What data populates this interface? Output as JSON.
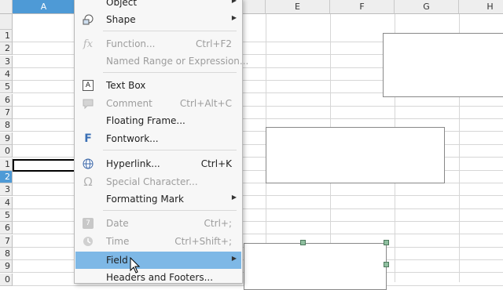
{
  "spreadsheet": {
    "columns": [
      {
        "label": "A",
        "selected": true
      },
      {
        "label": "",
        "selected": false
      },
      {
        "label": "",
        "selected": false
      },
      {
        "label": "",
        "selected": false
      },
      {
        "label": "E",
        "selected": false
      },
      {
        "label": "F",
        "selected": false
      },
      {
        "label": "G",
        "selected": false
      },
      {
        "label": "H",
        "selected": false
      }
    ],
    "rows": [
      "1",
      "2",
      "3",
      "4",
      "5",
      "6",
      "7",
      "8",
      "9",
      "0",
      "1",
      "2",
      "3",
      "4",
      "5",
      "6",
      "7",
      "8",
      "9",
      "0"
    ],
    "selected_row_index": 11,
    "selection_color": "#4e9ad6"
  },
  "context_menu": {
    "items": {
      "object": {
        "label": "Object",
        "submenu": true,
        "enabled": true
      },
      "shape": {
        "label": "Shape",
        "icon": "shape-icon",
        "submenu": true,
        "enabled": true
      },
      "function": {
        "label": "Function...",
        "icon": "fx-icon",
        "shortcut": "Ctrl+F2",
        "enabled": false
      },
      "named_range": {
        "label": "Named Range or Expression...",
        "enabled": false
      },
      "text_box": {
        "label": "Text Box",
        "icon": "text-box-icon",
        "enabled": true
      },
      "comment": {
        "label": "Comment",
        "icon": "comment-icon",
        "shortcut": "Ctrl+Alt+C",
        "enabled": false
      },
      "floating_frame": {
        "label": "Floating Frame...",
        "enabled": true
      },
      "fontwork": {
        "label": "Fontwork...",
        "icon": "fontwork-icon",
        "enabled": true
      },
      "hyperlink": {
        "label": "Hyperlink...",
        "icon": "globe-link-icon",
        "shortcut": "Ctrl+K",
        "enabled": true
      },
      "special_character": {
        "label": "Special Character...",
        "icon": "omega-icon",
        "enabled": false
      },
      "formatting_mark": {
        "label": "Formatting Mark",
        "submenu": true,
        "enabled": true
      },
      "date": {
        "label": "Date",
        "icon": "calendar-icon",
        "shortcut": "Ctrl+;",
        "enabled": false
      },
      "time": {
        "label": "Time",
        "icon": "clock-icon",
        "shortcut": "Ctrl+Shift+;",
        "enabled": false
      },
      "field": {
        "label": "Field",
        "submenu": true,
        "enabled": true,
        "highlighted": true
      },
      "headers_footers": {
        "label": "Headers and Footers...",
        "enabled": true
      }
    },
    "highlight_color": "#7eb8e6"
  }
}
